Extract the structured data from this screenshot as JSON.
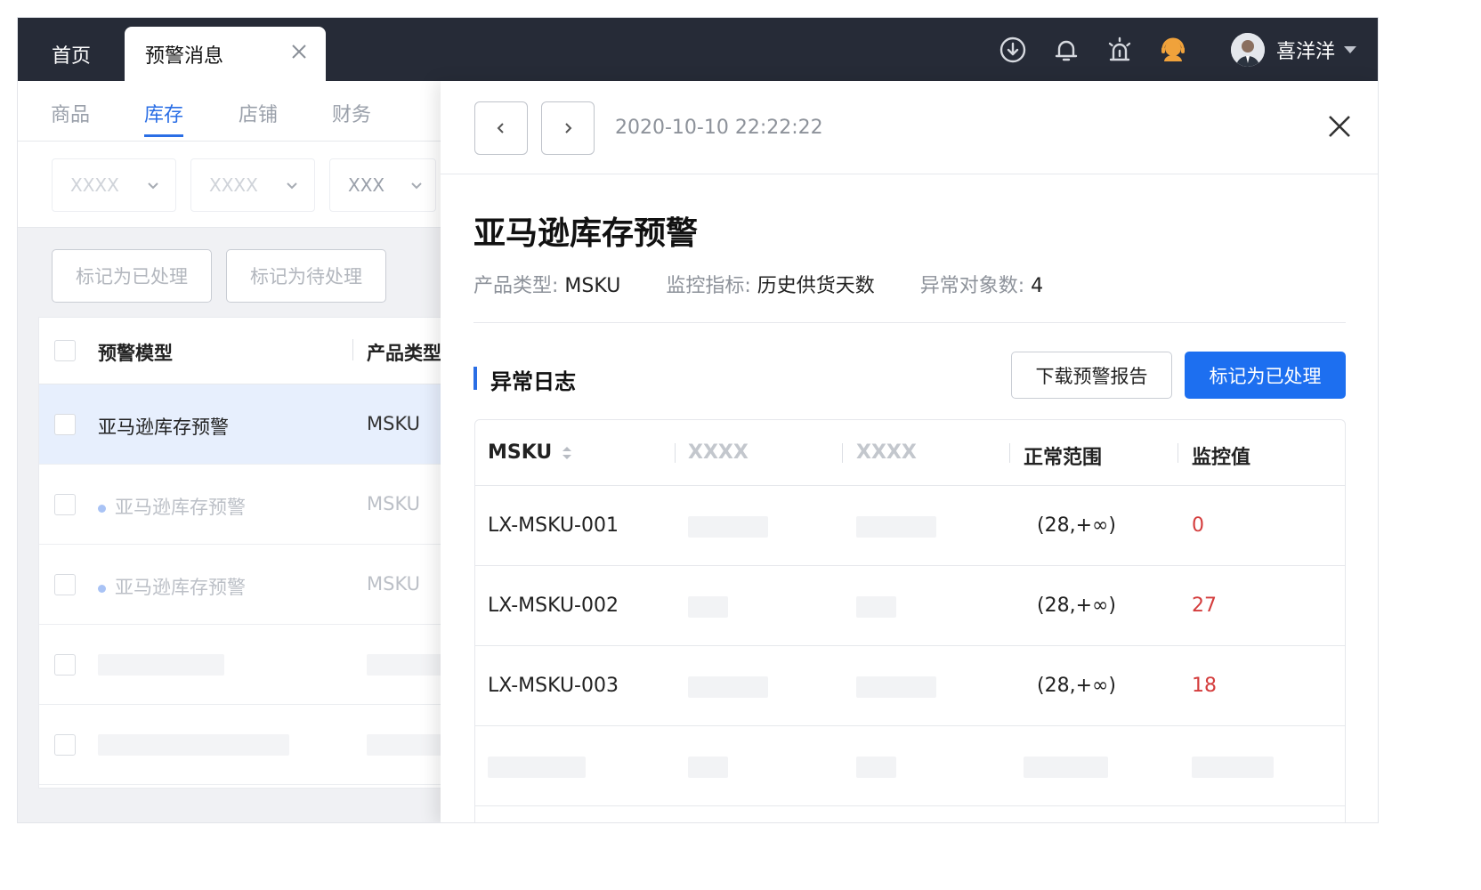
{
  "topbar": {
    "tabs": [
      {
        "label": "首页"
      },
      {
        "label": "预警消息"
      }
    ],
    "user": {
      "name": "喜洋洋"
    }
  },
  "left": {
    "subtabs": [
      "商品",
      "库存",
      "店铺",
      "财务"
    ],
    "active_subtab": "库存",
    "filters": [
      "XXXX",
      "XXXX",
      "XXX"
    ],
    "actions": {
      "mark_done": "标记为已处理",
      "mark_pending": "标记为待处理"
    },
    "table": {
      "headers": [
        "预警模型",
        "产品类型"
      ],
      "rows": [
        {
          "name": "亚马逊库存预警",
          "type": "MSKU"
        },
        {
          "name": "亚马逊库存预警",
          "type": "MSKU"
        },
        {
          "name": "亚马逊库存预警",
          "type": "MSKU"
        }
      ]
    }
  },
  "drawer": {
    "timestamp": "2020-10-10 22:22:22",
    "title": "亚马逊库存预警",
    "meta": {
      "product_type_label": "产品类型:",
      "product_type": "MSKU",
      "metric_label": "监控指标:",
      "metric": "历史供货天数",
      "anomaly_count_label": "异常对象数:",
      "anomaly_count": "4"
    },
    "section_title": "异常日志",
    "download_button": "下载预警报告",
    "mark_button": "标记为已处理",
    "table": {
      "headers": [
        "MSKU",
        "XXXX",
        "XXXX",
        "正常范围",
        "监控值"
      ],
      "rows": [
        {
          "msku": "LX-MSKU-001",
          "range": "(28,+∞)",
          "value": "0"
        },
        {
          "msku": "LX-MSKU-002",
          "range": "(28,+∞)",
          "value": "27"
        },
        {
          "msku": "LX-MSKU-003",
          "range": "(28,+∞)",
          "value": "18"
        }
      ]
    }
  },
  "colors": {
    "primary": "#1d6ff0",
    "topbar": "#262b37",
    "alert": "#d43c3c"
  }
}
